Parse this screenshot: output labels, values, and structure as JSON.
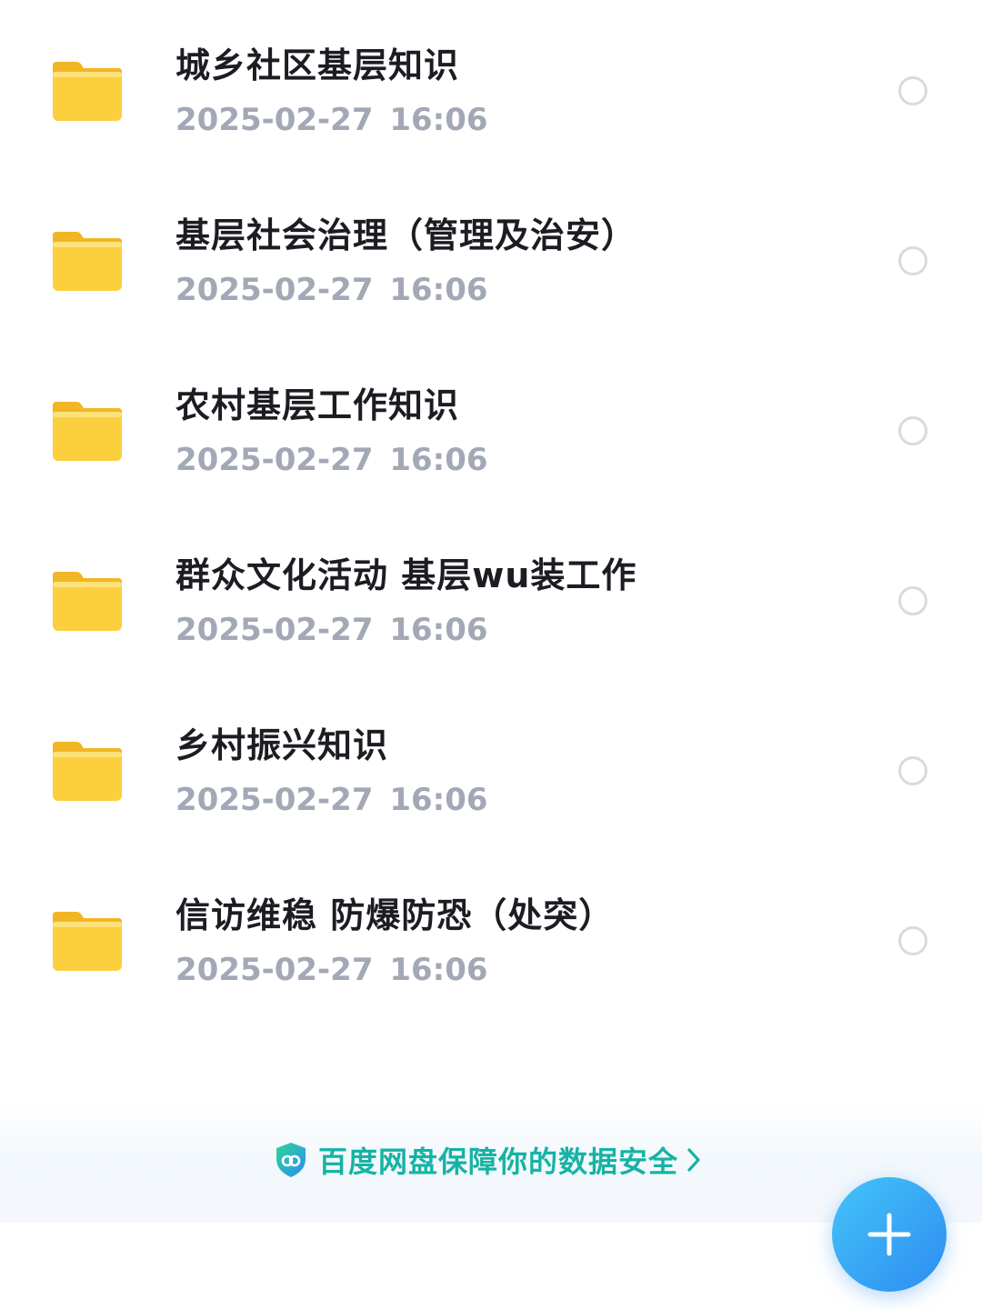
{
  "file_list": {
    "items": [
      {
        "name": "城乡社区基层知识",
        "date": "2025-02-27  16:06",
        "icon": "folder-icon"
      },
      {
        "name": "基层社会治理（管理及治安）",
        "date": "2025-02-27  16:06",
        "icon": "folder-icon"
      },
      {
        "name": "农村基层工作知识",
        "date": "2025-02-27  16:06",
        "icon": "folder-icon"
      },
      {
        "name": "群众文化活动 基层wu装工作",
        "date": "2025-02-27  16:06",
        "icon": "folder-icon"
      },
      {
        "name": "乡村振兴知识",
        "date": "2025-02-27  16:06",
        "icon": "folder-icon"
      },
      {
        "name": "信访维稳 防爆防恐（处突）",
        "date": "2025-02-27  16:06",
        "icon": "folder-icon"
      }
    ]
  },
  "footer": {
    "security_text": "百度网盘保障你的数据安全",
    "shield_icon": "shield-icon",
    "chevron_icon": "chevron-right-icon"
  },
  "fab": {
    "icon": "plus-icon"
  },
  "colors": {
    "folder": "#fccf3f",
    "title_text": "#1b1d22",
    "date_text": "#a3a8b6",
    "security_text": "#15b3a5",
    "fab_start": "#45c4f9",
    "fab_end": "#2d8cf0"
  }
}
